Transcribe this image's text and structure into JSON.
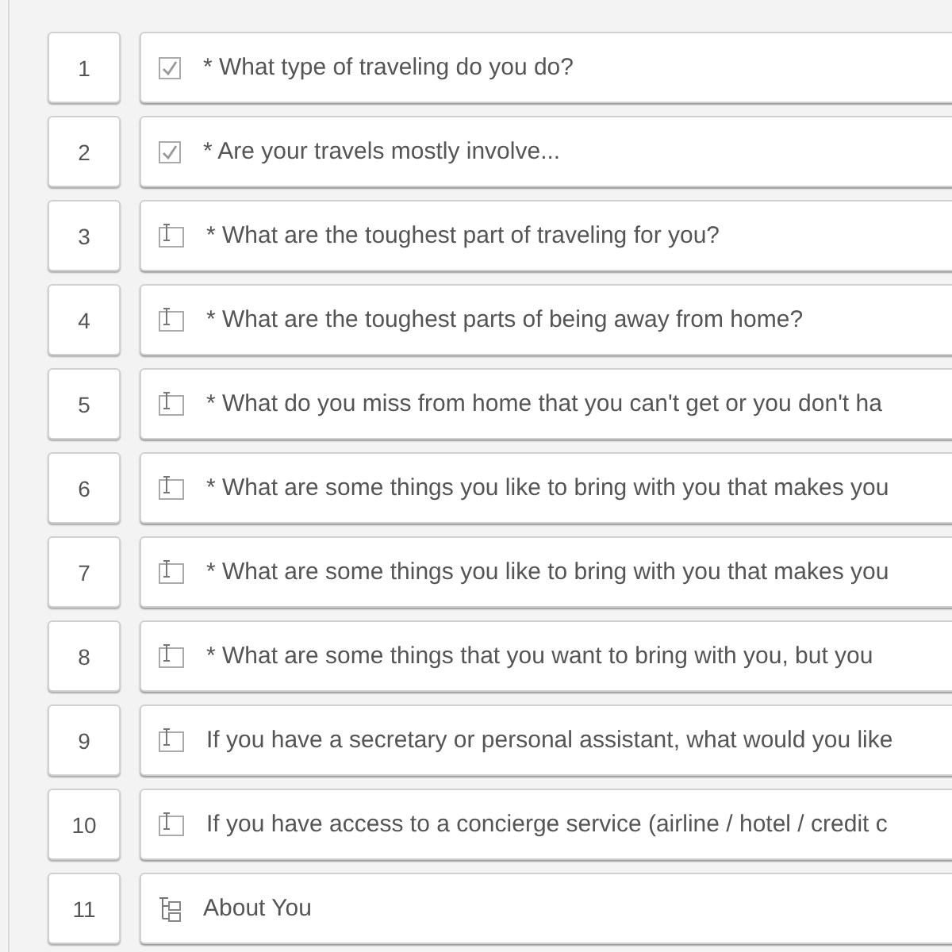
{
  "questions": [
    {
      "number": "1",
      "kind": "choice",
      "text": "* What type of traveling do you do?"
    },
    {
      "number": "2",
      "kind": "choice",
      "text": "* Are your travels mostly involve..."
    },
    {
      "number": "3",
      "kind": "text",
      "text": "* What are the toughest part of traveling for you?"
    },
    {
      "number": "4",
      "kind": "text",
      "text": "* What are the toughest parts of being away from home?"
    },
    {
      "number": "5",
      "kind": "text",
      "text": "* What do you miss from home that you can't get or you don't ha"
    },
    {
      "number": "6",
      "kind": "text",
      "text": "* What are some things you like to bring with you that makes you"
    },
    {
      "number": "7",
      "kind": "text",
      "text": "* What are some things you like to bring with you that makes you"
    },
    {
      "number": "8",
      "kind": "text",
      "text": "* What are some things that you want to bring with you, but you"
    },
    {
      "number": "9",
      "kind": "text",
      "text": "If you have a secretary or personal assistant, what would you like"
    },
    {
      "number": "10",
      "kind": "text",
      "text": "If you have access to a concierge service (airline / hotel / credit c"
    },
    {
      "number": "11",
      "kind": "section",
      "text": "About You"
    }
  ]
}
